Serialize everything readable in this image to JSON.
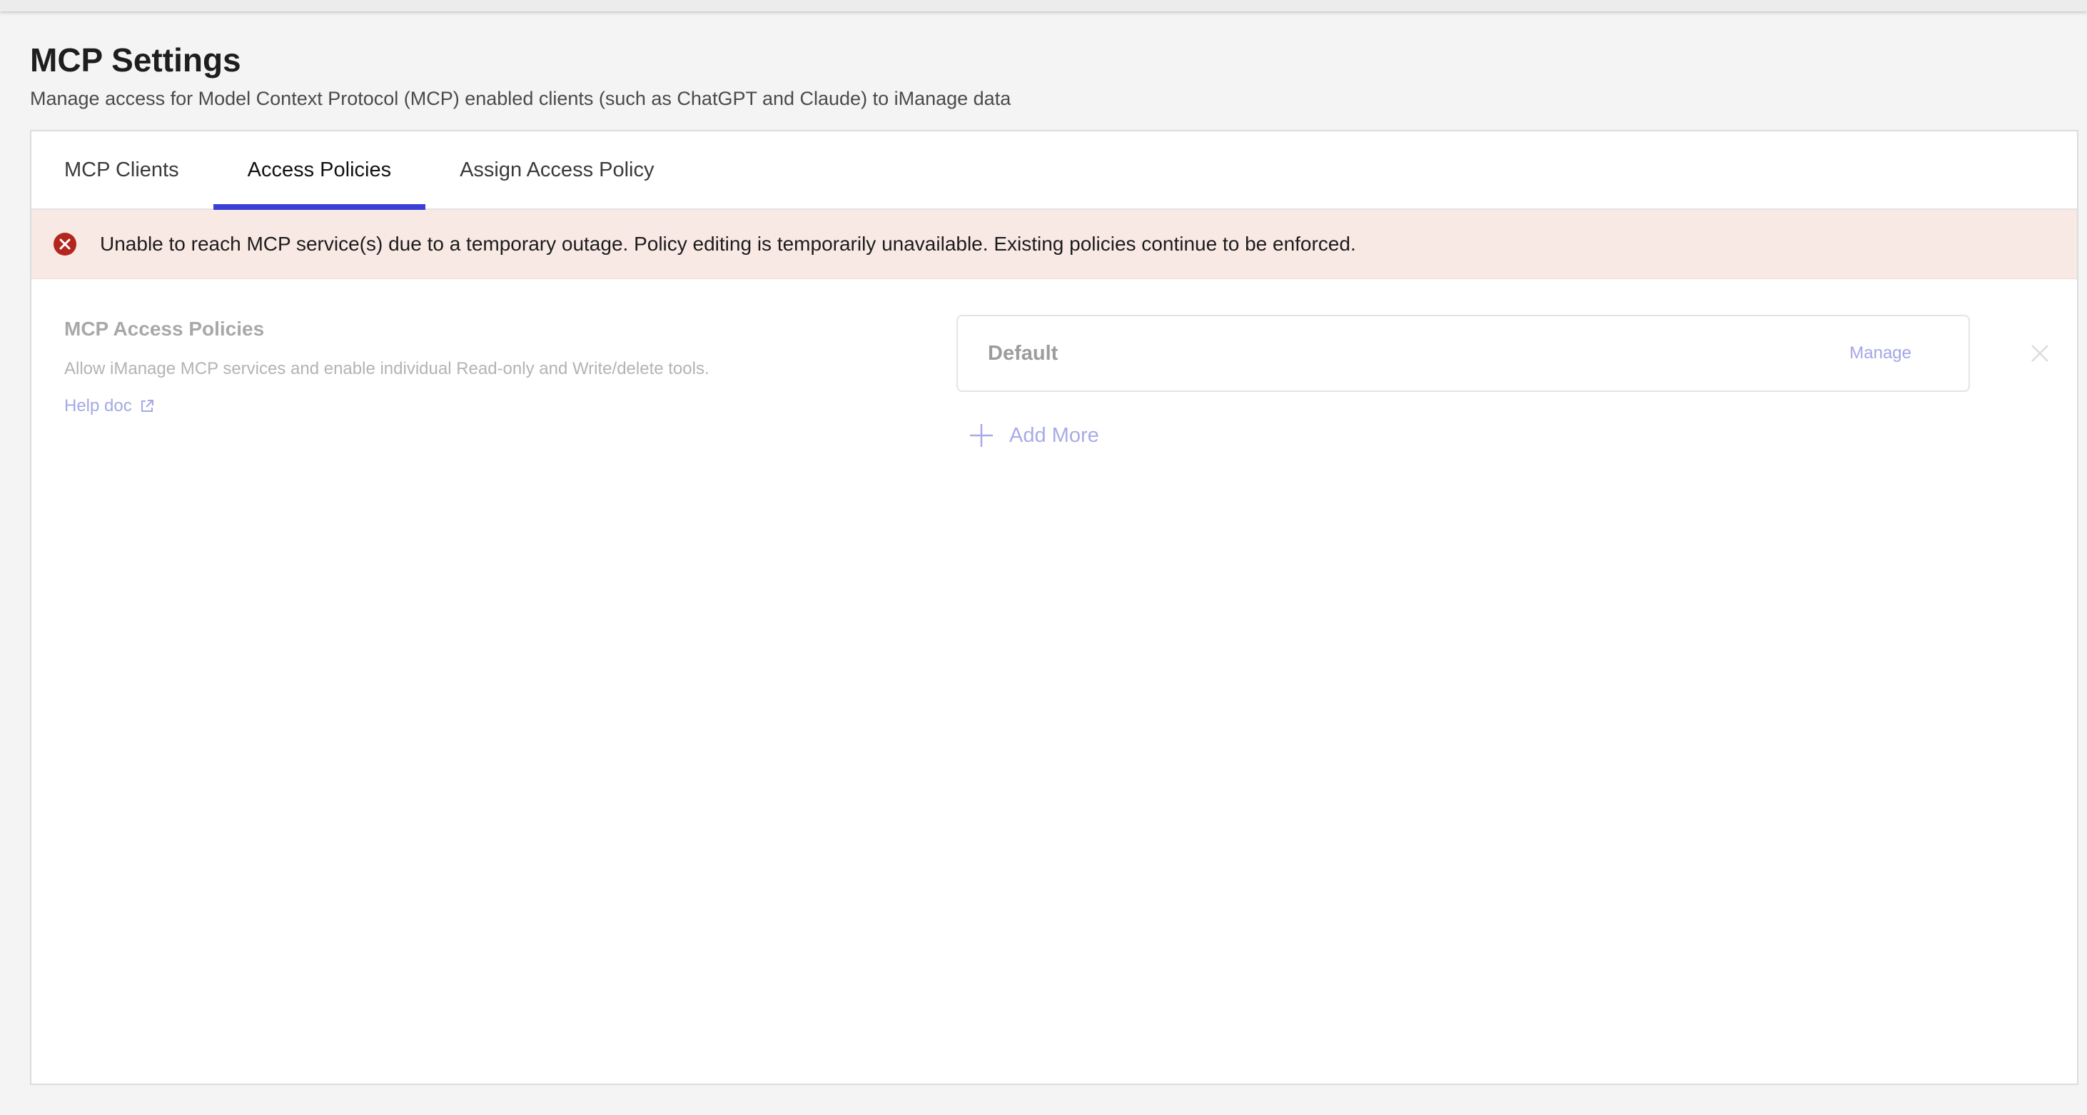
{
  "page": {
    "title": "MCP Settings",
    "subtitle": "Manage access for Model Context Protocol (MCP) enabled clients (such as ChatGPT and Claude) to iManage data"
  },
  "tabs": [
    {
      "label": "MCP Clients",
      "active": false
    },
    {
      "label": "Access Policies",
      "active": true
    },
    {
      "label": "Assign Access Policy",
      "active": false
    }
  ],
  "alert": {
    "icon": "error-circle-icon",
    "message": "Unable to reach MCP service(s) due to a temporary outage. Policy editing is temporarily unavailable. Existing policies continue to be enforced."
  },
  "section": {
    "title": "MCP Access Policies",
    "description": "Allow iManage MCP services and enable individual Read-only and Write/delete tools.",
    "help_label": "Help doc",
    "help_icon": "external-link-icon"
  },
  "policies": [
    {
      "name": "Default",
      "manage_label": "Manage",
      "remove_icon": "close-icon"
    }
  ],
  "add_more": {
    "label": "Add More",
    "icon": "plus-icon"
  },
  "colors": {
    "accent": "#3b3fd6",
    "alert_bg": "#f8e9e4",
    "alert_icon": "#b3261e",
    "link_disabled": "#a4a8e6"
  }
}
